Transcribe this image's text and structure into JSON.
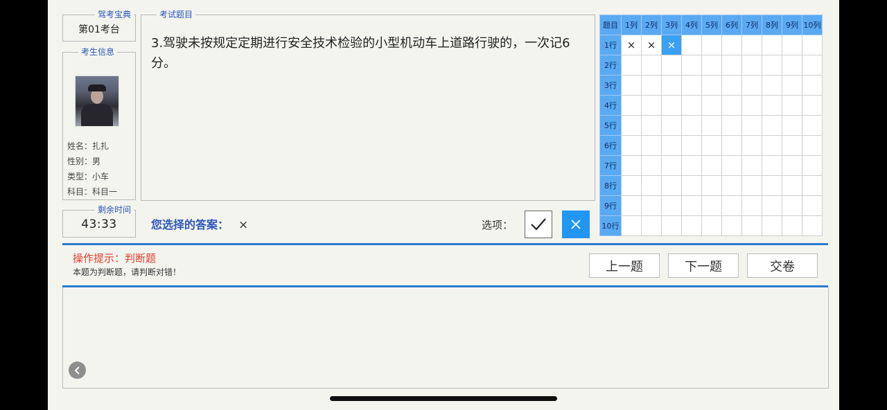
{
  "exam_info": {
    "legend": "驾考宝典",
    "value": "第01考台"
  },
  "examinee": {
    "legend": "考生信息",
    "name": "姓名：扎扎",
    "gender": "性别：男",
    "type": "类型：小车",
    "subject": "科目：科目一"
  },
  "timer": {
    "legend": "剩余时间",
    "value": "43:33"
  },
  "question": {
    "legend": "考试题目",
    "text": "3.驾驶未按规定定期进行安全技术检验的小型机动车上道路行驶的，一次记6分。"
  },
  "answer": {
    "label": "您选择的答案：",
    "value": "×"
  },
  "options": {
    "label": "选项：",
    "true_symbol": "✓",
    "false_symbol": "×",
    "selected": "false"
  },
  "answer_grid": {
    "corner": "题目",
    "columns": [
      "1列",
      "2列",
      "3列",
      "4列",
      "5列",
      "6列",
      "7列",
      "8列",
      "9列",
      "10列"
    ],
    "rows": [
      "1行",
      "2行",
      "3行",
      "4行",
      "5行",
      "6行",
      "7行",
      "8行",
      "9行",
      "10行"
    ],
    "marks": [
      [
        "×",
        "×",
        "×",
        "",
        "",
        "",
        "",
        "",
        "",
        ""
      ]
    ],
    "current": [
      0,
      2
    ]
  },
  "hint": {
    "title": "操作提示：判断题",
    "text": "本题为判断题，请判断对错！"
  },
  "buttons": {
    "prev": "上一题",
    "next": "下一题",
    "submit": "交卷"
  },
  "colors": {
    "accent": "#2196f3",
    "grid_header": "#5aa9f1",
    "divider": "#2b7bcc",
    "hint": "#e0402f"
  }
}
